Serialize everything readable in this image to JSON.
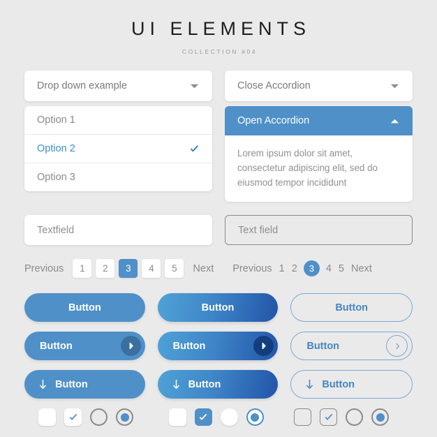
{
  "header": {
    "title": "UI ELEMENTS",
    "subtitle": "COLLECTION #04"
  },
  "colors": {
    "background": "#eaeaea",
    "accent_blue": "#4f90c8",
    "gradient_start": "#4fa2d6",
    "gradient_end": "#2255a8",
    "text_gray": "#8a8a8a",
    "outline_gray": "#8b8b8b"
  },
  "dropdown": {
    "header_label": "Drop down example",
    "chevron": "chevron-down-icon",
    "options": [
      {
        "label": "Option 1",
        "selected": false
      },
      {
        "label": "Option 2",
        "selected": true
      },
      {
        "label": "Option 3",
        "selected": false
      }
    ]
  },
  "accordion": {
    "closed": {
      "label": "Close Accordion",
      "chevron": "chevron-down-icon"
    },
    "open": {
      "label": "Open Accordion",
      "chevron": "chevron-up-icon",
      "body": "Lorem ipsum dolor sit amet, consectetur adipiscing elit, sed do eiusmod tempor incididunt"
    }
  },
  "textfields": {
    "solid": {
      "value": "Textfield",
      "placeholder": "Textfield"
    },
    "outline": {
      "value": "Text field",
      "placeholder": "Text field"
    }
  },
  "pagination_boxed": {
    "previous_label": "Previous",
    "next_label": "Next",
    "pages": [
      "1",
      "2",
      "3",
      "4",
      "5"
    ],
    "active_page": "3"
  },
  "pagination_plain": {
    "previous_label": "Previous",
    "next_label": "Next",
    "pages": [
      "1",
      "2",
      "3",
      "4",
      "5"
    ],
    "active_page": "3"
  },
  "buttons": {
    "row1": [
      {
        "label": "Button",
        "style": "flat"
      },
      {
        "label": "Button",
        "style": "gradient"
      },
      {
        "label": "Button",
        "style": "outline"
      }
    ],
    "row2": [
      {
        "label": "Button",
        "style": "flat",
        "icon": "chevron-right-icon"
      },
      {
        "label": "Button",
        "style": "gradient",
        "icon": "chevron-right-icon"
      },
      {
        "label": "Button",
        "style": "outline",
        "icon": "chevron-right-icon"
      }
    ],
    "row3": [
      {
        "label": "Button",
        "style": "flat",
        "icon": "download-arrow-icon"
      },
      {
        "label": "Button",
        "style": "gradient",
        "icon": "download-arrow-icon"
      },
      {
        "label": "Button",
        "style": "outline",
        "icon": "download-arrow-icon"
      }
    ]
  },
  "toggles": {
    "group1": {
      "checkbox_unchecked": {
        "checked": false,
        "style": "white"
      },
      "checkbox_checked": {
        "checked": true,
        "style": "white"
      },
      "radio_unselected": {
        "selected": false,
        "style": "gray-ring"
      },
      "radio_selected": {
        "selected": true,
        "style": "gray-ring"
      }
    },
    "group2": {
      "checkbox_unchecked": {
        "checked": false,
        "style": "white"
      },
      "checkbox_checked": {
        "checked": true,
        "style": "blue-fill"
      },
      "radio_unselected": {
        "selected": false,
        "style": "white"
      },
      "radio_selected": {
        "selected": true,
        "style": "blue-ring"
      }
    },
    "group3": {
      "checkbox_unchecked": {
        "checked": false,
        "style": "outline"
      },
      "checkbox_checked": {
        "checked": true,
        "style": "outline"
      },
      "radio_unselected": {
        "selected": false,
        "style": "gray-ring"
      },
      "radio_selected": {
        "selected": true,
        "style": "gray-ring"
      }
    }
  }
}
